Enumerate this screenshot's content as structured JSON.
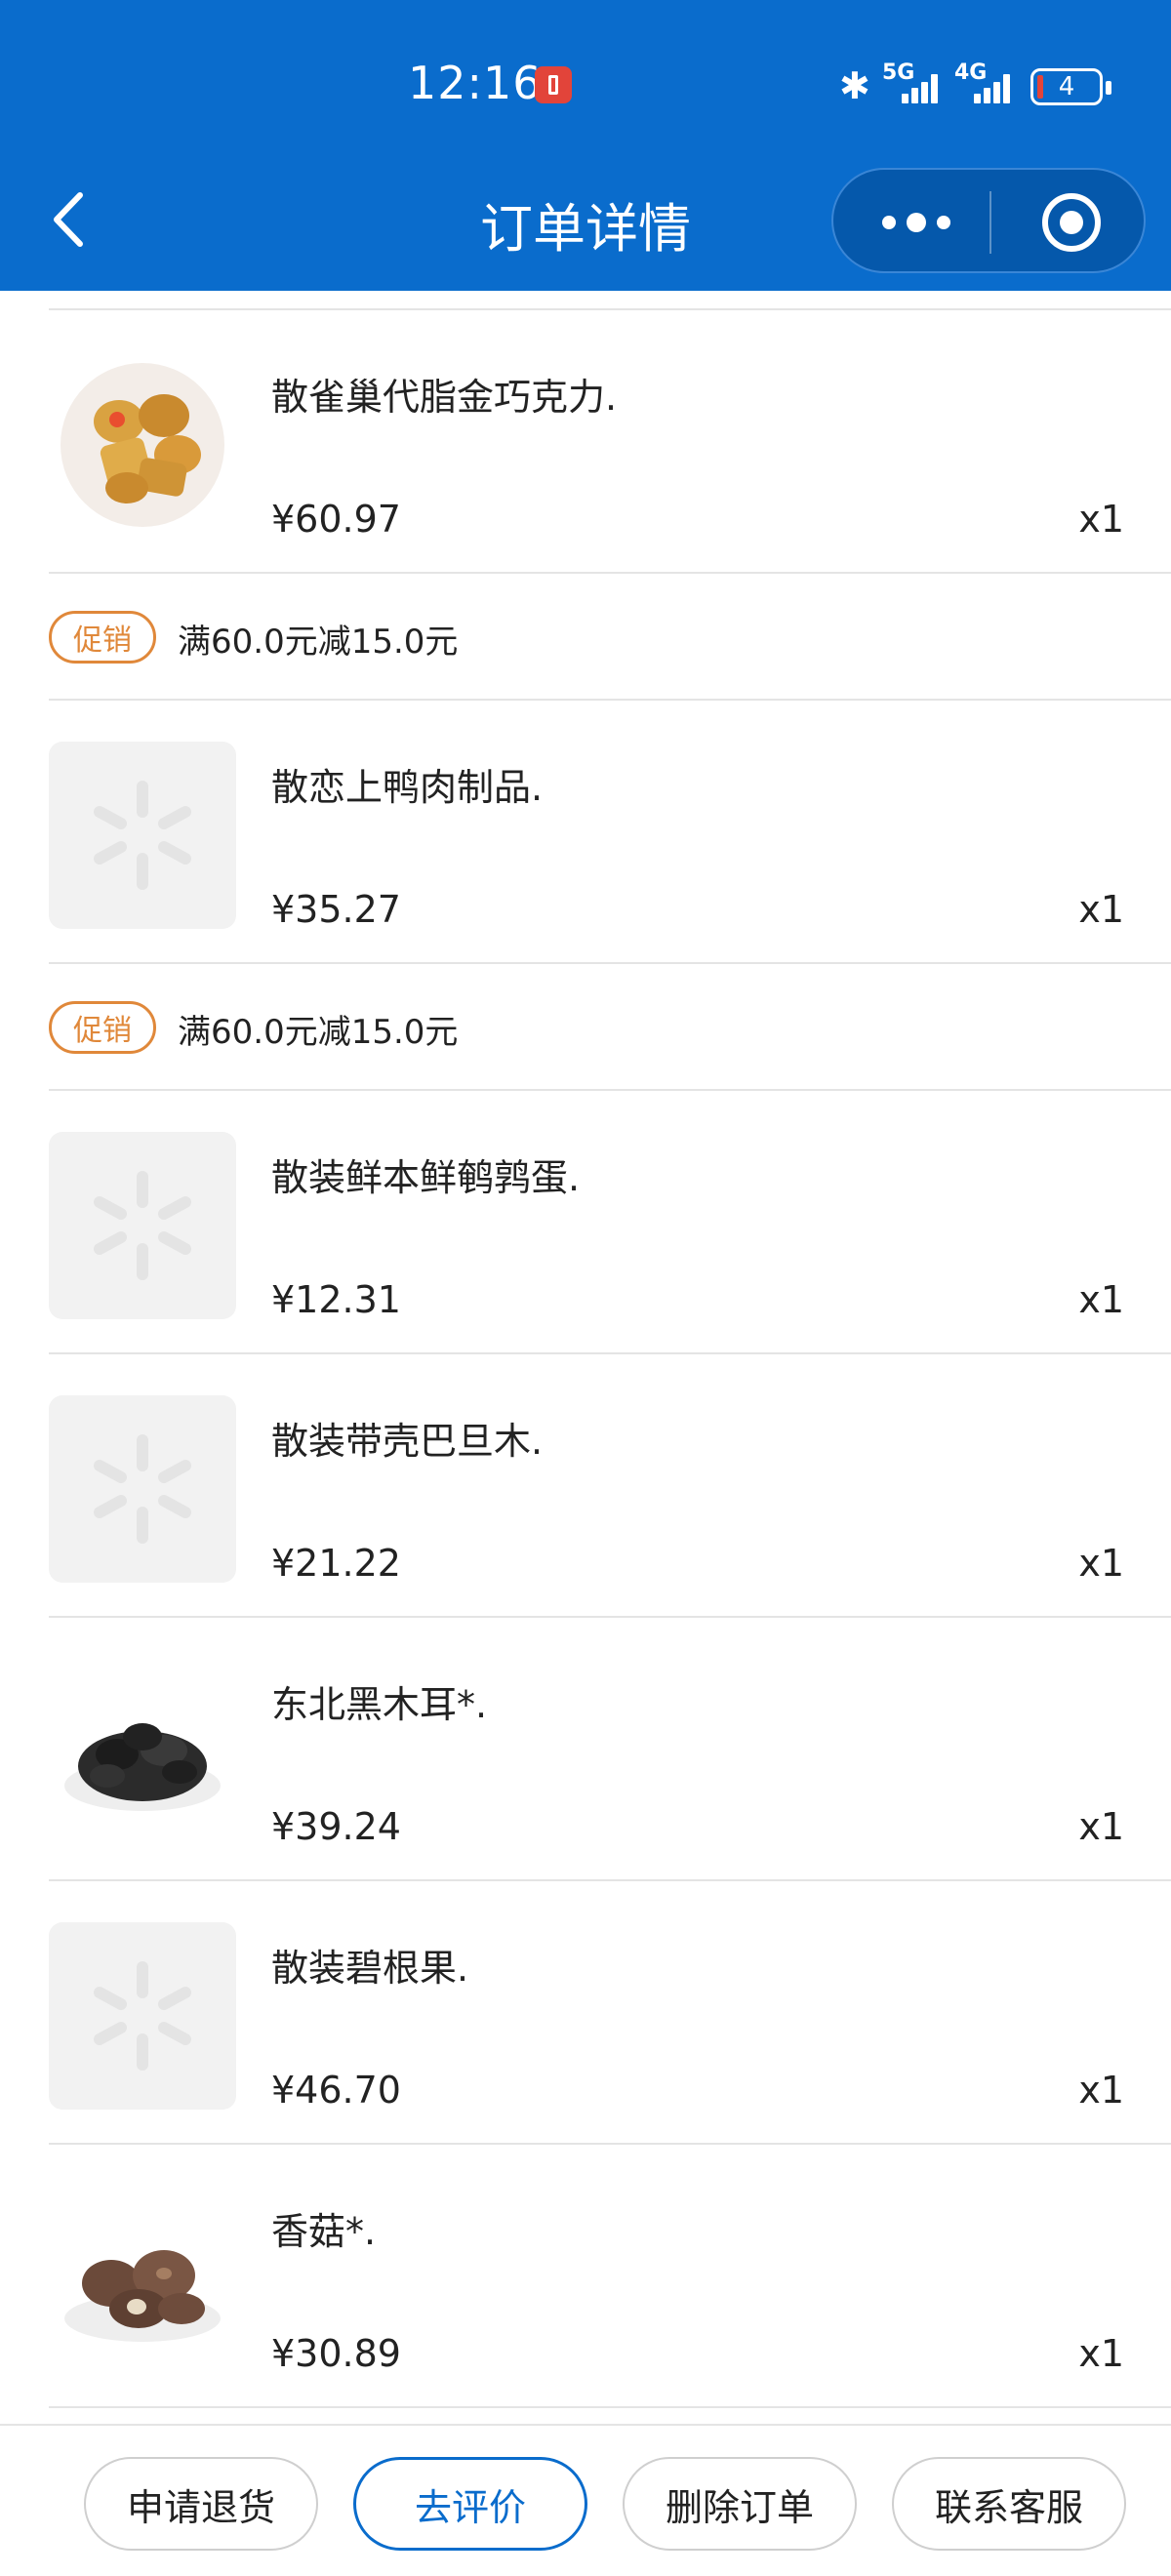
{
  "status_bar": {
    "time": "12:16",
    "network1": "5G",
    "network2": "4G",
    "battery": "4"
  },
  "header": {
    "title": "订单详情"
  },
  "items": [
    {
      "name": "散雀巢代脂金巧克力.",
      "price": "¥60.97",
      "qty": "x1",
      "thumb": "chocolate-coins"
    },
    {
      "promo_tag": "促销",
      "promo_text": "满60.0元减15.0元"
    },
    {
      "name": "散恋上鸭肉制品.",
      "price": "¥35.27",
      "qty": "x1",
      "thumb": "placeholder"
    },
    {
      "promo_tag": "促销",
      "promo_text": "满60.0元减15.0元"
    },
    {
      "name": "散装鲜本鲜鹌鹑蛋.",
      "price": "¥12.31",
      "qty": "x1",
      "thumb": "placeholder"
    },
    {
      "name": "散装带壳巴旦木.",
      "price": "¥21.22",
      "qty": "x1",
      "thumb": "placeholder"
    },
    {
      "name": "东北黑木耳*.",
      "price": "¥39.24",
      "qty": "x1",
      "thumb": "black-fungus"
    },
    {
      "name": "散装碧根果.",
      "price": "¥46.70",
      "qty": "x1",
      "thumb": "placeholder"
    },
    {
      "name": "香菇*.",
      "price": "¥30.89",
      "qty": "x1",
      "thumb": "shiitake"
    }
  ],
  "actions": {
    "return": "申请退货",
    "review": "去评价",
    "delete": "删除订单",
    "contact": "联系客服"
  },
  "colors": {
    "header_bg": "#0a6ccc",
    "promo": "#e0883a",
    "primary": "#0a6ccc"
  }
}
